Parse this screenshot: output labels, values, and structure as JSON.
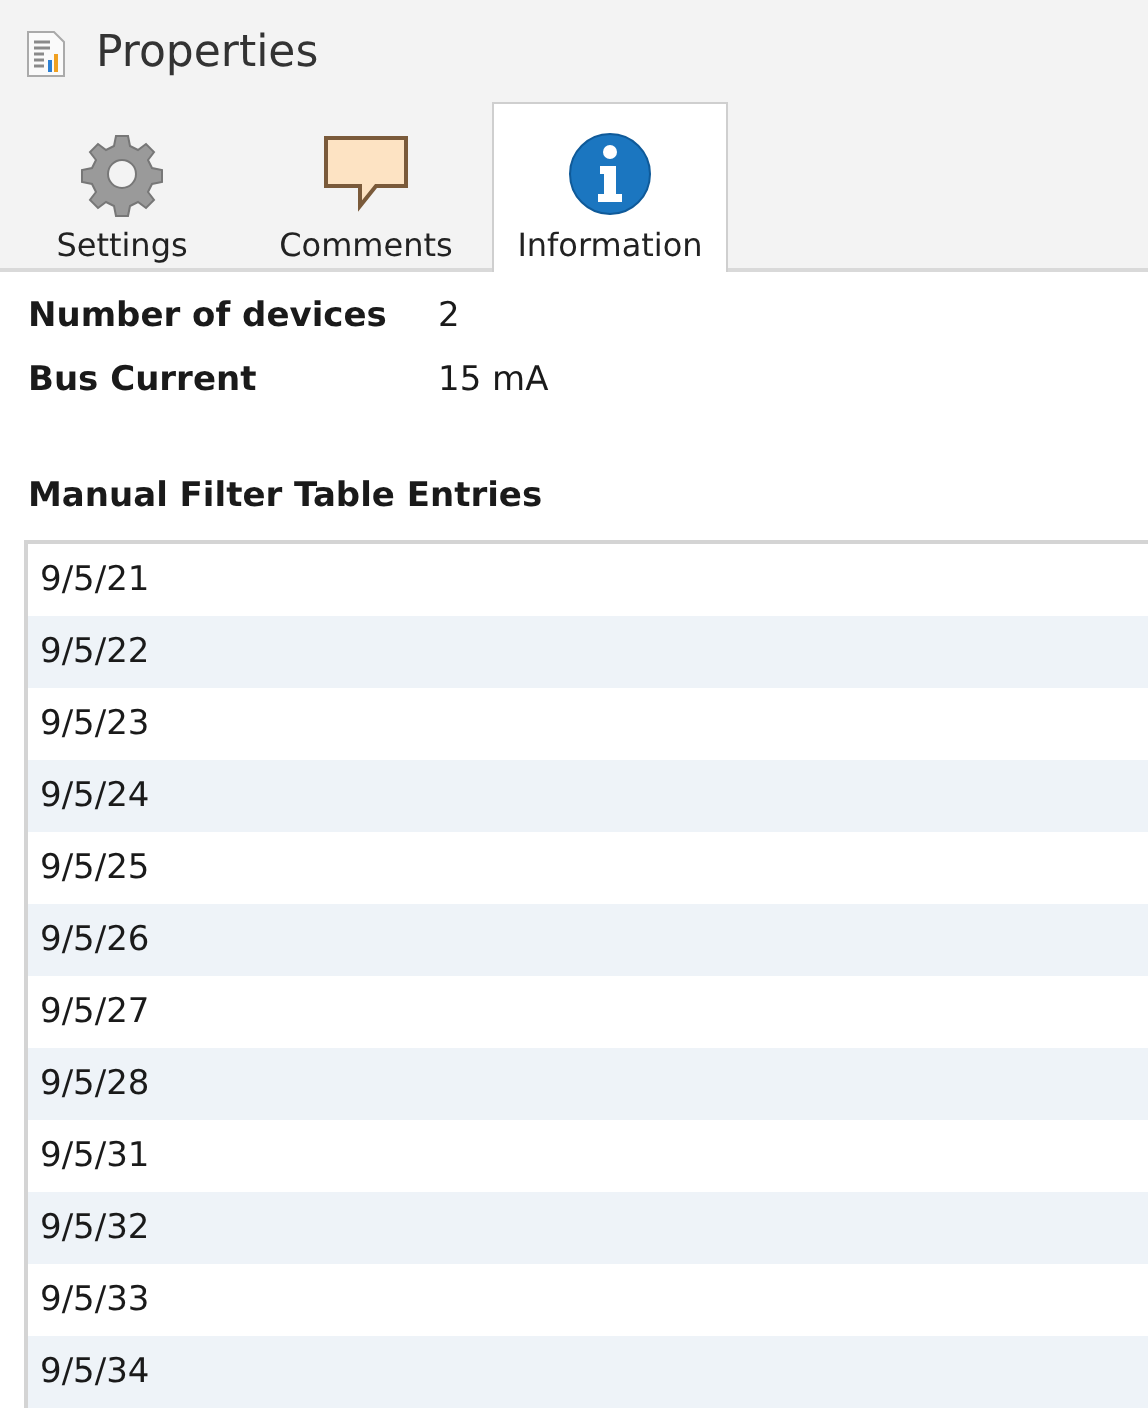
{
  "panel": {
    "title": "Properties"
  },
  "tabs": [
    {
      "label": "Settings",
      "kind": "gear",
      "selected": false
    },
    {
      "label": "Comments",
      "kind": "comment",
      "selected": false
    },
    {
      "label": "Information",
      "kind": "info",
      "selected": true
    }
  ],
  "properties": [
    {
      "label": "Number of devices",
      "value": "2"
    },
    {
      "label": "Bus Current",
      "value": "15 mA"
    }
  ],
  "filter_table": {
    "title": "Manual Filter Table Entries",
    "rows": [
      "9/5/21",
      "9/5/22",
      "9/5/23",
      "9/5/24",
      "9/5/25",
      "9/5/26",
      "9/5/27",
      "9/5/28",
      "9/5/31",
      "9/5/32",
      "9/5/33",
      "9/5/34"
    ]
  }
}
